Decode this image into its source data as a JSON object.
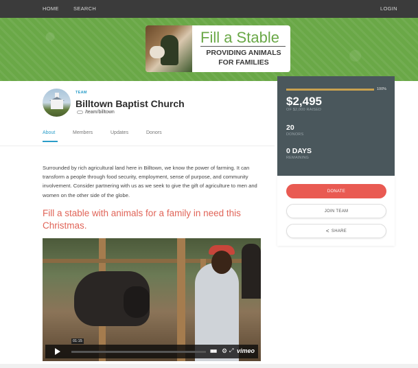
{
  "nav": {
    "home": "HOME",
    "search": "SEARCH",
    "login": "LOGIN"
  },
  "banner": {
    "title": "Fill a Stable",
    "subtitle_line1": "PROVIDING ANIMALS",
    "subtitle_line2": "FOR FAMILIES"
  },
  "team": {
    "tag": "TEAM",
    "name": "Billtown Baptist Church",
    "link": "/team/billtown"
  },
  "tabs": [
    {
      "label": "About",
      "active": true
    },
    {
      "label": "Members",
      "active": false
    },
    {
      "label": "Updates",
      "active": false
    },
    {
      "label": "Donors",
      "active": false
    }
  ],
  "description": "Surrounded by rich agricultural land here in Billtown, we know the power of farming. It can transform a people through food security, employment, sense of purpose, and community involvement. Consider partnering with us as we seek to give the gift of agriculture to men and women on the other side of the globe.",
  "heading": "Fill a stable with animals for a family in need this Christmas.",
  "video": {
    "time": "01:15",
    "logo": "vimeo",
    "progress": 0.0
  },
  "stats": {
    "progress_pct": "100%",
    "progress_fraction": 1.0,
    "raised": "$2,495",
    "goal": "OF $2,000 RAISED",
    "donors_value": "20",
    "donors_label": "DONORS",
    "days_value": "0 DAYS",
    "days_label": "REMAINING"
  },
  "actions": {
    "donate": "DONATE",
    "join": "JOIN TEAM",
    "share": "SHARE"
  },
  "colors": {
    "accent": "#2a9dc9",
    "donate": "#e95a52",
    "heading": "#e06458",
    "banner_green": "#6aa847",
    "stats_bg": "#4a575c",
    "progress": "#c9a14f"
  }
}
